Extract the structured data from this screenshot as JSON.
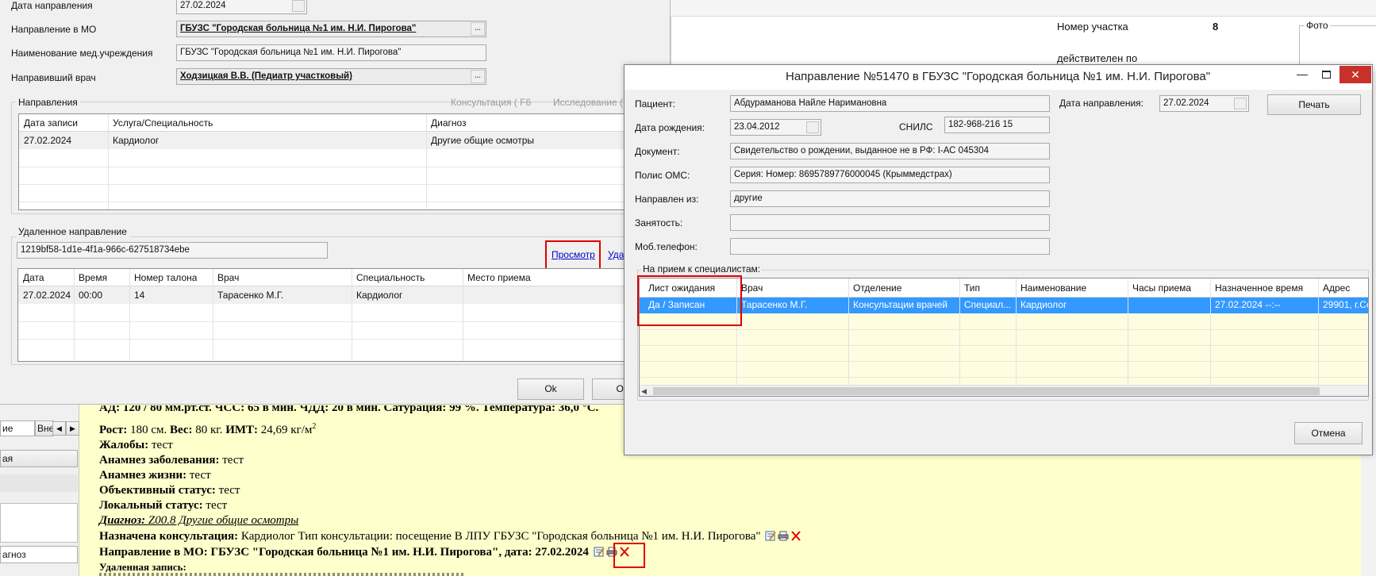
{
  "left_dialog": {
    "date_label": "Дата направления",
    "date_value": "27.02.2024",
    "mo_label": "Направление в МО",
    "mo_value": "ГБУЗС \"Городская больница №1 им. Н.И. Пирогова\"",
    "inst_label": "Наименование мед.учреждения",
    "inst_value": "ГБУЗС \"Городская больница №1 им. Н.И. Пирогова\"",
    "doctor_label": "Направивший врач",
    "doctor_value": "Ходзицкая В.В. (Педиатр участковый)",
    "directions_label": "Направления",
    "consult_hint": "Консультация ( F6",
    "research_hint": "Исследование (",
    "directions_table": {
      "headers": [
        "Дата записи",
        "Услуга/Специальность",
        "Диагноз"
      ],
      "row": [
        "27.02.2024",
        "Кардиолог",
        "Другие общие осмотры"
      ]
    },
    "remote_label": "Удаленное направление",
    "remote_guid": "1219bf58-1d1e-4f1a-966c-627518734ebe",
    "view_link": "Просмотр",
    "delete_link": "Уда",
    "remote_table": {
      "headers": [
        "Дата",
        "Время",
        "Номер талона",
        "Врач",
        "Специальность",
        "Место приема"
      ],
      "row": [
        "27.02.2024",
        "00:00",
        "14",
        "Тарасенко М.Г.",
        "Кардиолог",
        ""
      ]
    },
    "ok_button": "Ok",
    "cancel_button": "Отм"
  },
  "background_panel": {
    "uchastok_label": "Номер участка",
    "uchastok_value": "8",
    "valid_label": "действителен по",
    "photo_label": "Фото"
  },
  "left_sidebar": {
    "tab1": "ие",
    "tab2": "Внешне",
    "item1": "ая",
    "item2": "агноз"
  },
  "record": {
    "line0": "АД: 120 / 80 мм.рт.ст. ЧСС: 65 в мин. ЧДД: 20 в мин. Сатурация: 99 %. Температура: 36,0 °С.",
    "growth_label": "Рост:",
    "growth_value": "180 см.",
    "weight_label": "Вес:",
    "weight_value": "80 кг.",
    "bmi_label": "ИМТ:",
    "bmi_value": "24,69 кг/м",
    "bmi_sup": "2",
    "complaints_label": "Жалобы:",
    "complaints_value": "тест",
    "anamnesis_label": "Анамнез заболевания:",
    "anamnesis_value": "тест",
    "life_label": "Анамнез жизни:",
    "life_value": "тест",
    "objective_label": "Объективный статус:",
    "objective_value": "тест",
    "local_label": "Локальный статус:",
    "local_value": "тест",
    "diagnosis_label": "Диагноз:",
    "diagnosis_value": "Z00.8 Другие общие осмотры",
    "consult_label": "Назначена консультация:",
    "consult_value": "Кардиолог Тип консультации: посещение В ЛПУ ГБУЗС \"Городская больница №1 им. Н.И. Пирогова\"",
    "direction_line": "Направление в МО: ГБУЗС \"Городская больница №1 им. Н.И. Пирогова\", дата: 27.02.2024",
    "removed_label": "Удаленная запись:"
  },
  "popup": {
    "title": "Направление №51470 в ГБУЗС \"Городская больница №1 им. Н.И. Пирогова\"",
    "patient_label": "Пациент:",
    "patient_value": "Абдураманова Найле Наримановна",
    "dob_label": "Дата рождения:",
    "dob_value": "23.04.2012",
    "snils_label": "СНИЛС",
    "snils_value": "182-968-216 15",
    "date_label": "Дата направления:",
    "date_value": "27.02.2024",
    "print_button": "Печать",
    "doc_label": "Документ:",
    "doc_value": "Свидетельство о рождении, выданное не в РФ: I-АС 045304",
    "oms_label": "Полис ОМС:",
    "oms_value": "Серия:  Номер: 8695789776000045 (Крыммедстрах)",
    "from_label": "Направлен из:",
    "from_value": "другие",
    "employment_label": "Занятость:",
    "employment_value": "",
    "phone_label": "Моб.телефон:",
    "phone_value": "",
    "specialists_label": "На прием к специалистам:",
    "table": {
      "headers": [
        "Лист ожидания",
        "Врач",
        "Отделение",
        "Тип",
        "Наименование",
        "Часы приема",
        "Назначенное время",
        "Адрес"
      ],
      "row": [
        "Да / Записан",
        "Тарасенко М.Г.",
        "Консультации врачей",
        "Специал...",
        "Кардиолог",
        "",
        "27.02.2024 --:--",
        "29901, г.Се"
      ]
    },
    "cancel_button": "Отмена"
  },
  "colors": {
    "selection": "#3399ff",
    "record_bg": "#ffffcc",
    "highlight": "#e00000",
    "waitlist_bg": "#fffde0"
  }
}
